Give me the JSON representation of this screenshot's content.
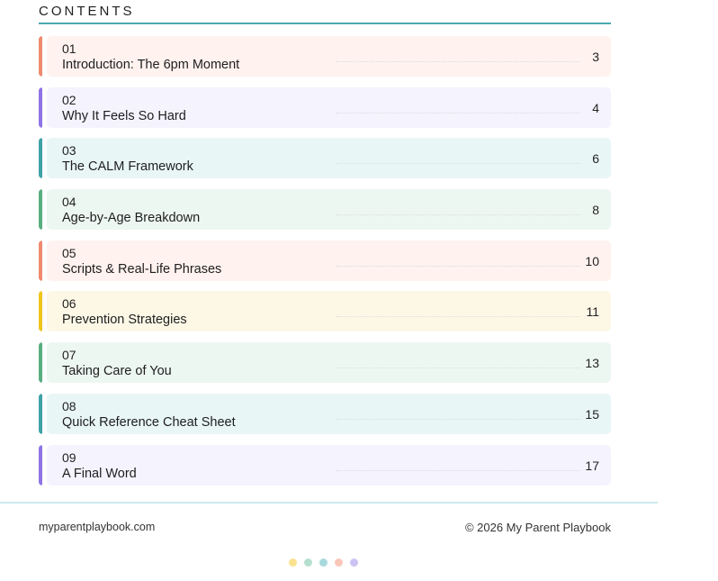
{
  "heading": "CONTENTS",
  "colors": {
    "rule": "#4ba8ad",
    "footer_rule": "#cdeaec"
  },
  "items": [
    {
      "num": "01",
      "title": "Introduction: The 6pm Moment",
      "page": "3",
      "accent": "#ef8a6e",
      "bg": "#fff2ef"
    },
    {
      "num": "02",
      "title": "Why It Feels So Hard",
      "page": "4",
      "accent": "#8f74e6",
      "bg": "#f5f3fe"
    },
    {
      "num": "03",
      "title": "The CALM Framework",
      "page": "6",
      "accent": "#3fa2a6",
      "bg": "#e9f6f6"
    },
    {
      "num": "04",
      "title": "Age-by-Age Breakdown",
      "page": "8",
      "accent": "#5aae80",
      "bg": "#edf7f2"
    },
    {
      "num": "05",
      "title": "Scripts & Real-Life Phrases",
      "page": "10",
      "accent": "#ef8a6e",
      "bg": "#fff2ef"
    },
    {
      "num": "06",
      "title": "Prevention Strategies",
      "page": "11",
      "accent": "#efc51f",
      "bg": "#fdf8e6"
    },
    {
      "num": "07",
      "title": "Taking Care of You",
      "page": "13",
      "accent": "#5aae80",
      "bg": "#edf7f2"
    },
    {
      "num": "08",
      "title": "Quick Reference Cheat Sheet",
      "page": "15",
      "accent": "#3fa2a6",
      "bg": "#e9f6f6"
    },
    {
      "num": "09",
      "title": "A Final Word",
      "page": "17",
      "accent": "#8f74e6",
      "bg": "#f5f3fe"
    }
  ],
  "footer": {
    "left": "myparentplaybook.com",
    "right": "© 2026 My Parent Playbook"
  },
  "dots": [
    "#fbe28f",
    "#b7dfd0",
    "#a9d9dc",
    "#f9c6b8",
    "#cdc2f4"
  ]
}
